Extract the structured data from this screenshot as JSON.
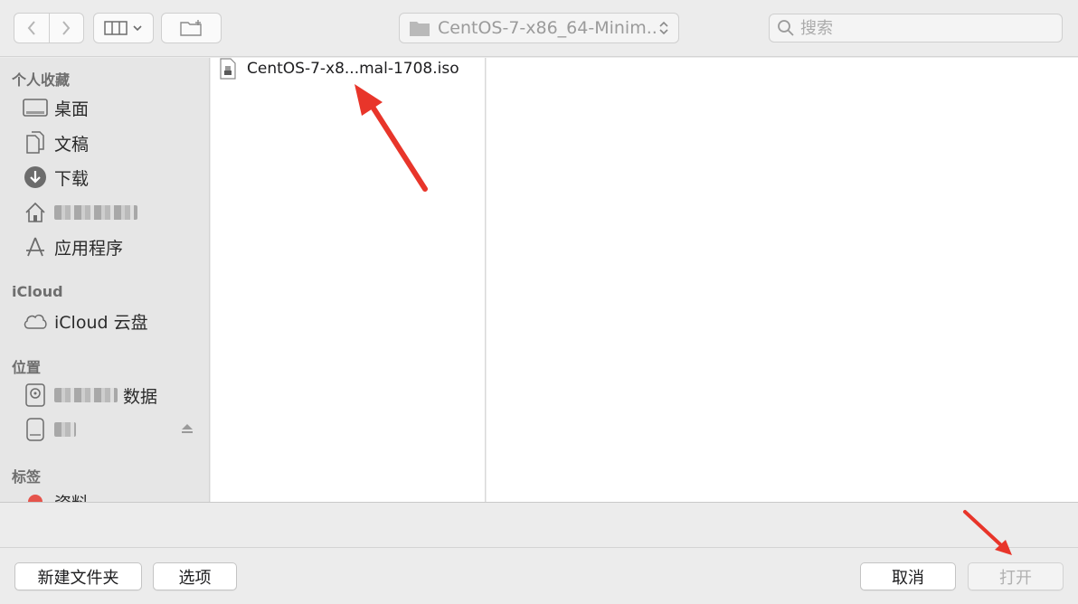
{
  "toolbar": {
    "path_label": "CentOS-7-x86_64-Minim...",
    "search_placeholder": "搜索"
  },
  "sidebar": {
    "favorites": {
      "title": "个人收藏",
      "items": [
        {
          "label": "桌面",
          "icon": "desktop-icon"
        },
        {
          "label": "文稿",
          "icon": "documents-icon"
        },
        {
          "label": "下载",
          "icon": "downloads-icon"
        },
        {
          "label": "",
          "icon": "home-icon"
        },
        {
          "label": "应用程序",
          "icon": "applications-icon"
        }
      ]
    },
    "icloud": {
      "title": "iCloud",
      "items": [
        {
          "label": "iCloud 云盘",
          "icon": "cloud-icon"
        }
      ]
    },
    "locations": {
      "title": "位置",
      "items": [
        {
          "label": "数据",
          "icon": "disk-icon"
        },
        {
          "label": "",
          "icon": "external-drive-icon"
        }
      ]
    },
    "tags": {
      "title": "标签",
      "items": [
        {
          "label": "资料",
          "color": "#e5534b"
        }
      ]
    }
  },
  "files": [
    {
      "name": "CentOS-7-x8...mal-1708.iso",
      "icon": "disk-image-icon"
    }
  ],
  "buttons": {
    "new_folder": "新建文件夹",
    "options": "选项",
    "cancel": "取消",
    "open": "打开"
  },
  "colors": {
    "annotation_arrow": "#e8352a",
    "tag_red": "#e5534b"
  }
}
